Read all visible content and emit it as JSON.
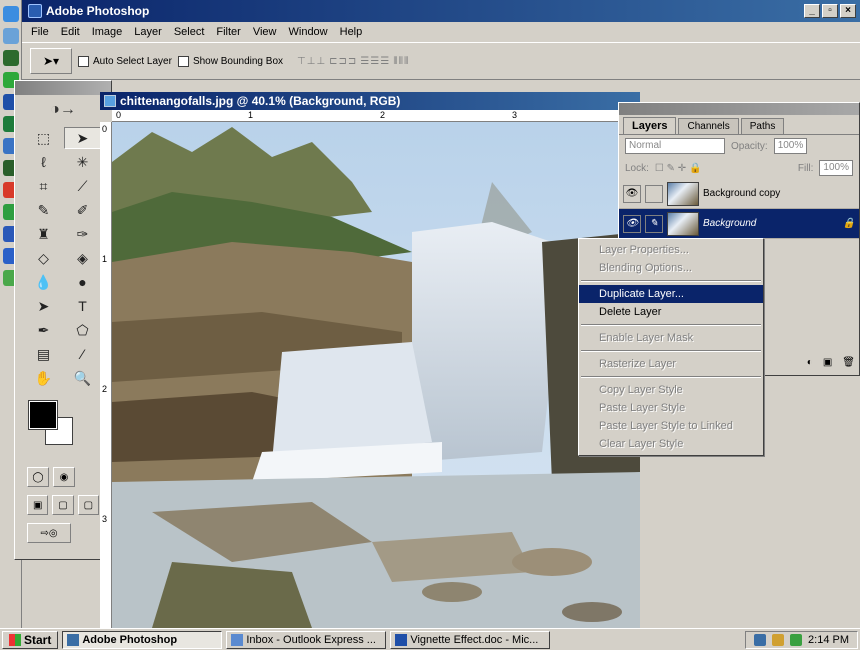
{
  "app": {
    "title": "Adobe Photoshop"
  },
  "menu": [
    "File",
    "Edit",
    "Image",
    "Layer",
    "Select",
    "Filter",
    "View",
    "Window",
    "Help"
  ],
  "options": {
    "auto_select": "Auto Select Layer",
    "show_bbox": "Show Bounding Box"
  },
  "document": {
    "title": "chittenangofalls.jpg @ 40.1% (Background, RGB)",
    "ruler_h": [
      "0",
      "1",
      "2",
      "3"
    ],
    "ruler_v": [
      "0",
      "1",
      "2",
      "3"
    ]
  },
  "layers": {
    "tabs": [
      "Layers",
      "Channels",
      "Paths"
    ],
    "blend_mode": "Normal",
    "opacity_label": "Opacity:",
    "opacity_value": "100%",
    "lock_label": "Lock:",
    "fill_label": "Fill:",
    "fill_value": "100%",
    "items": [
      {
        "name": "Background copy"
      },
      {
        "name": "Background"
      }
    ]
  },
  "context_menu": {
    "group1": [
      "Layer Properties...",
      "Blending Options..."
    ],
    "duplicate": "Duplicate Layer...",
    "delete": "Delete Layer",
    "mask": "Enable Layer Mask",
    "rasterize": "Rasterize Layer",
    "group2": [
      "Copy Layer Style",
      "Paste Layer Style",
      "Paste Layer Style to Linked",
      "Clear Layer Style"
    ]
  },
  "taskbar": {
    "start": "Start",
    "tasks": [
      "Adobe Photoshop",
      "Inbox - Outlook Express ...",
      "Vignette Effect.doc - Mic..."
    ],
    "clock": "2:14 PM"
  }
}
